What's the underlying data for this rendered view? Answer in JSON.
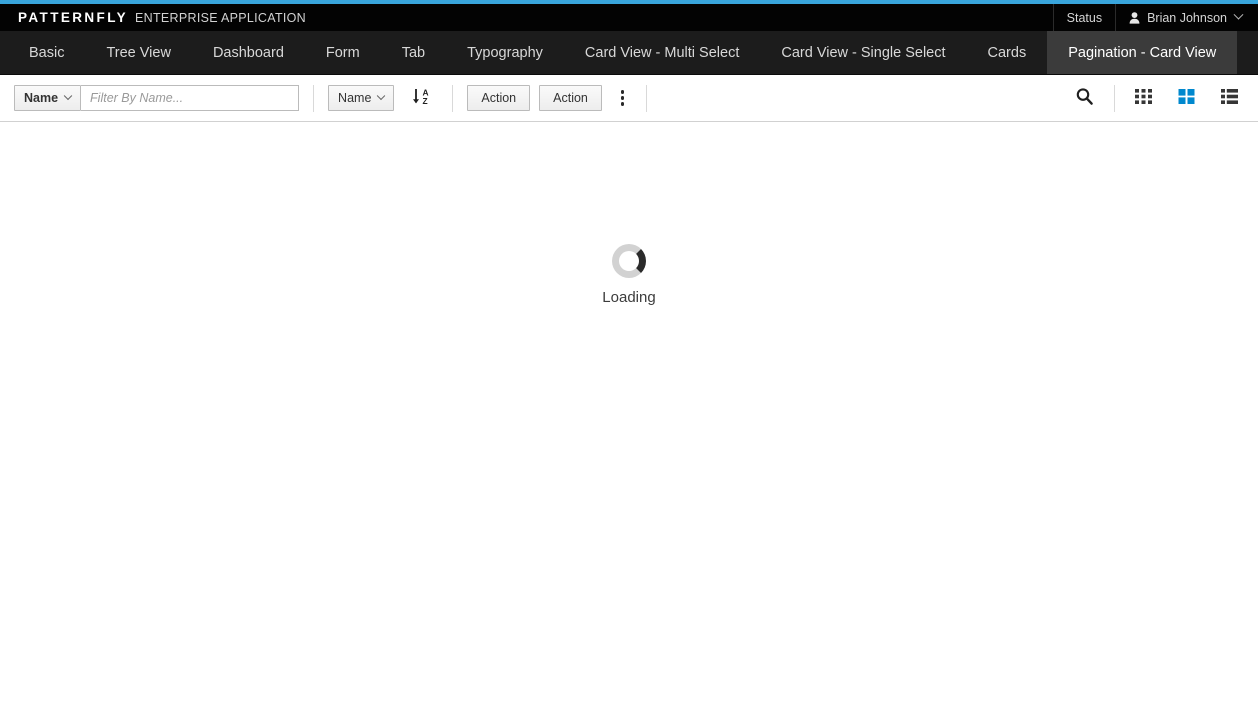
{
  "theme": {
    "accent_blue": "#39a5dc",
    "masthead_bg": "#030303",
    "navbar_bg": "#1c1c1c",
    "active_tab_bg": "#3b3b3b",
    "active_toggle_color": "#0088ce",
    "body_bg": "#ffffff"
  },
  "masthead": {
    "brand_primary": "PATTERNFLY",
    "brand_secondary": "ENTERPRISE APPLICATION",
    "status_label": "Status",
    "user_name": "Brian Johnson",
    "user_icon": "user-icon",
    "caret_icon": "chevron-down-icon"
  },
  "nav": {
    "items": [
      {
        "label": "Basic",
        "active": false
      },
      {
        "label": "Tree View",
        "active": false
      },
      {
        "label": "Dashboard",
        "active": false
      },
      {
        "label": "Form",
        "active": false
      },
      {
        "label": "Tab",
        "active": false
      },
      {
        "label": "Typography",
        "active": false
      },
      {
        "label": "Card View - Multi Select",
        "active": false
      },
      {
        "label": "Card View - Single Select",
        "active": false
      },
      {
        "label": "Cards",
        "active": false
      },
      {
        "label": "Pagination - Card View",
        "active": true
      }
    ]
  },
  "toolbar": {
    "filter": {
      "field_label": "Name",
      "field_caret_icon": "chevron-down-icon",
      "input_value": "",
      "input_placeholder": "Filter By Name..."
    },
    "sort": {
      "field_label": "Name",
      "field_caret_icon": "chevron-down-icon",
      "direction_icon": "sort-alpha-asc-icon",
      "direction": "ascending",
      "letter_top": "A",
      "letter_bottom": "Z"
    },
    "actions": [
      {
        "label": "Action"
      },
      {
        "label": "Action"
      }
    ],
    "kebab_icon": "kebab-vertical-icon",
    "search_icon": "search-icon",
    "view_toggles": [
      {
        "name": "table-view-toggle",
        "icon": "grid-3x3-icon",
        "active": false
      },
      {
        "name": "card-view-toggle",
        "icon": "grid-2x2-icon",
        "active": true
      },
      {
        "name": "list-view-toggle",
        "icon": "list-icon",
        "active": false
      }
    ]
  },
  "content": {
    "loading_text": "Loading",
    "spinner_icon": "spinner-icon"
  }
}
